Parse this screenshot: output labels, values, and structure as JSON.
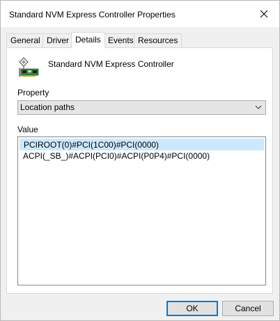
{
  "window": {
    "title": "Standard NVM Express Controller Properties"
  },
  "tabs": [
    {
      "label": "General"
    },
    {
      "label": "Driver"
    },
    {
      "label": "Details"
    },
    {
      "label": "Events"
    },
    {
      "label": "Resources"
    }
  ],
  "active_tab": "Details",
  "device": {
    "name": "Standard NVM Express Controller",
    "icon": "storage-controller-icon"
  },
  "property": {
    "label": "Property",
    "selected": "Location paths"
  },
  "value": {
    "label": "Value",
    "items": [
      {
        "text": "PCIROOT(0)#PCI(1C00)#PCI(0000)",
        "selected": true
      },
      {
        "text": "ACPI(_SB_)#ACPI(PCI0)#ACPI(P0P4)#PCI(0000)",
        "selected": false
      }
    ]
  },
  "buttons": {
    "ok": "OK",
    "cancel": "Cancel"
  },
  "colors": {
    "selection": "#cce8ff",
    "accent": "#0078d7"
  }
}
